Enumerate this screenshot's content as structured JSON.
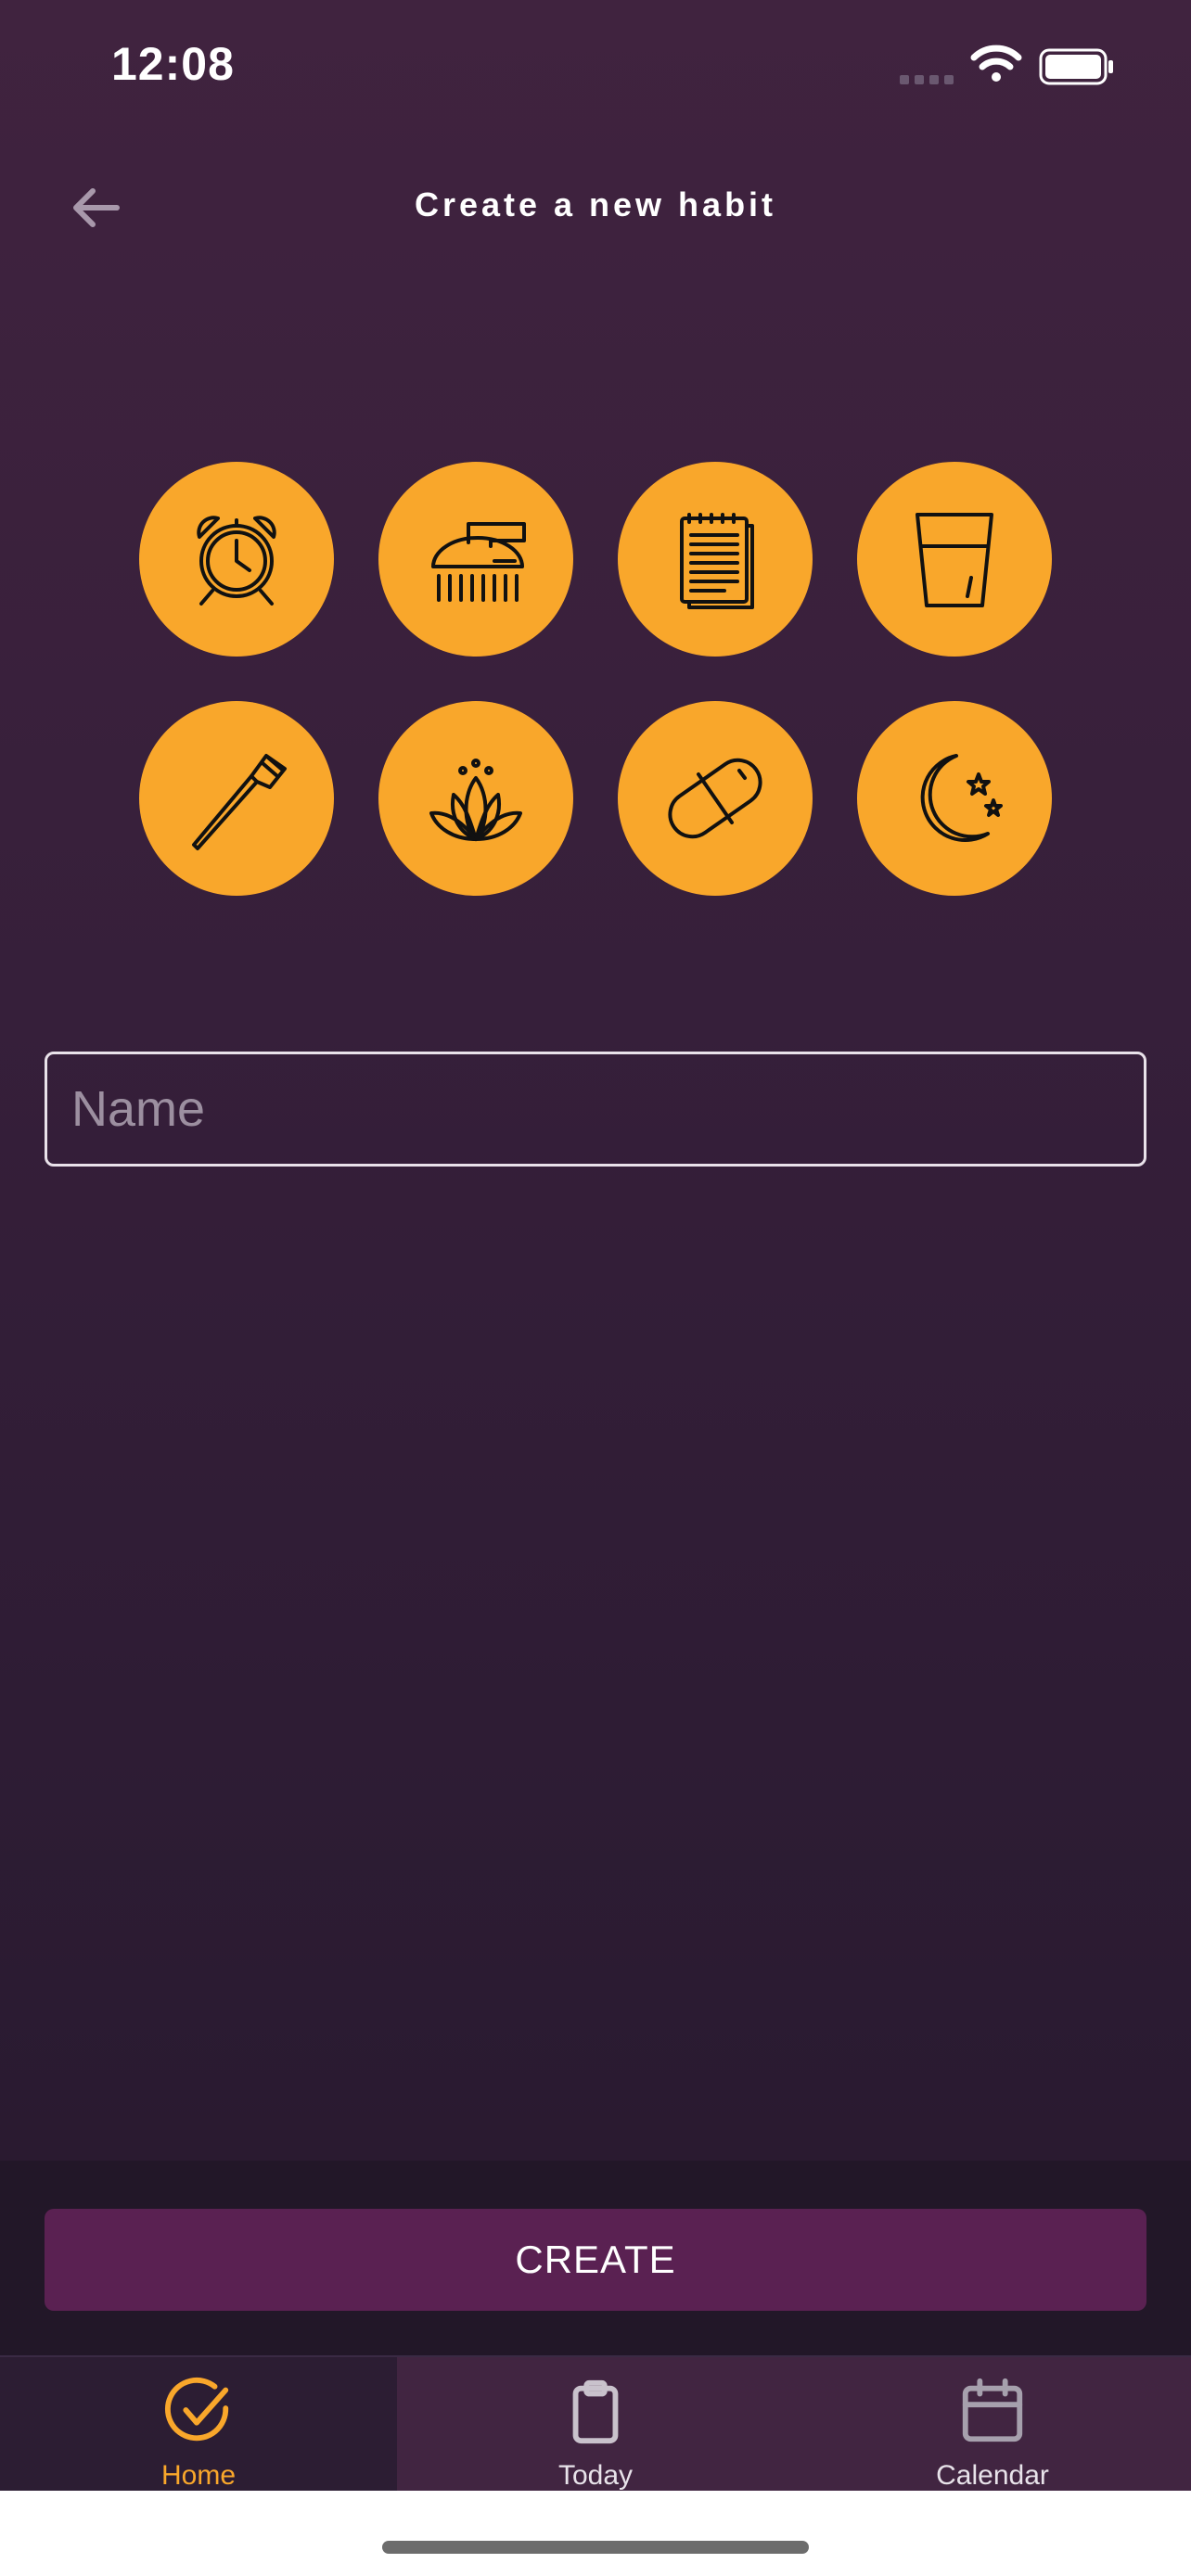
{
  "status_bar": {
    "time": "12:08",
    "icons": [
      "cellular-signal-icon",
      "wifi-icon",
      "battery-icon"
    ]
  },
  "header": {
    "title": "Create a new habit",
    "back_icon": "back-arrow-icon"
  },
  "habit_icons": [
    {
      "name": "alarm-clock-icon"
    },
    {
      "name": "shower-icon"
    },
    {
      "name": "notepad-icon"
    },
    {
      "name": "water-glass-icon"
    },
    {
      "name": "toothbrush-icon"
    },
    {
      "name": "lotus-icon"
    },
    {
      "name": "pill-icon"
    },
    {
      "name": "moon-stars-icon"
    }
  ],
  "form": {
    "name_placeholder": "Name",
    "name_value": ""
  },
  "create_button": {
    "label": "CREATE"
  },
  "tab_bar": {
    "tabs": [
      {
        "label": "Home",
        "icon": "check-circle-icon",
        "active": true
      },
      {
        "label": "Today",
        "icon": "clipboard-icon",
        "active": false
      },
      {
        "label": "Calendar",
        "icon": "calendar-icon",
        "active": false
      }
    ]
  },
  "colors": {
    "accent": "#f9a72b",
    "background_top": "#40233f",
    "background_bottom": "#27182c",
    "button": "#5a2152"
  }
}
